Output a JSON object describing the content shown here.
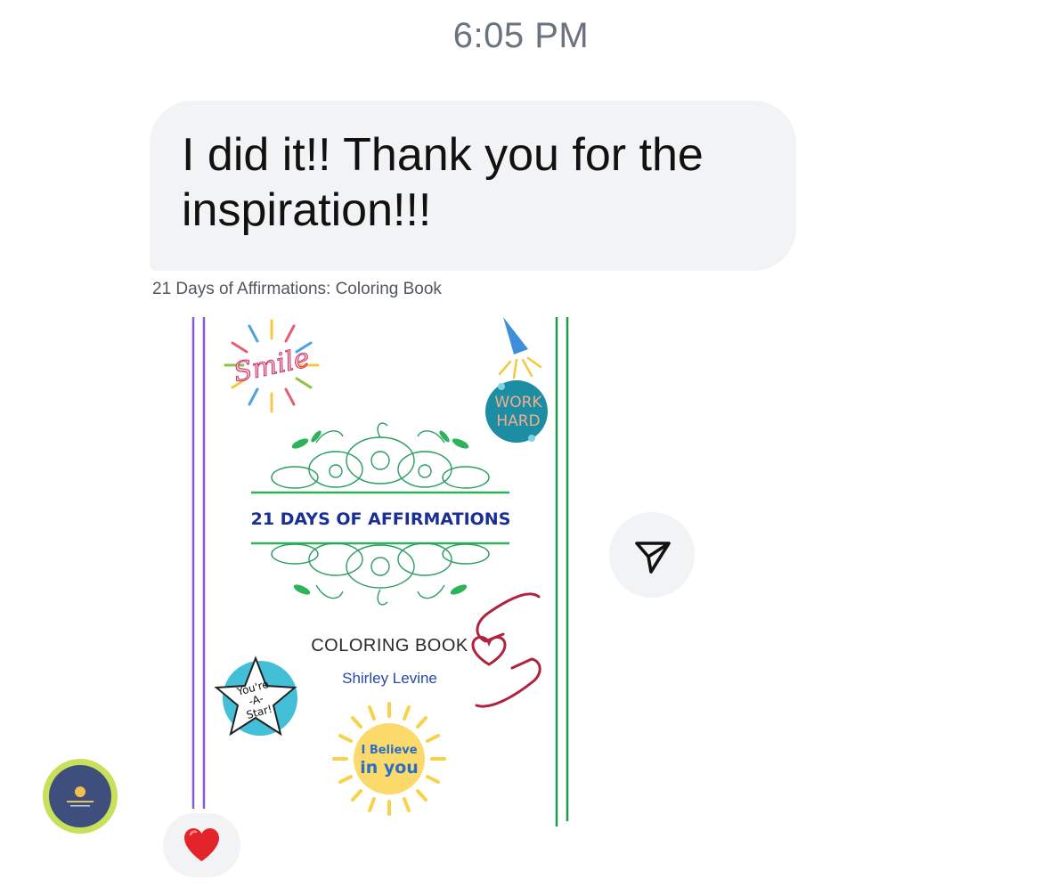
{
  "status": {
    "time": "6:05 PM"
  },
  "message": {
    "text": "I did it!! Thank you for the inspiration!!!",
    "attachment_caption": "21 Days of Affirmations: Coloring Book"
  },
  "cover": {
    "title": "21 DAYS OF AFFIRMATIONS",
    "subtitle": "COLORING BOOK",
    "author": "Shirley Levine",
    "sticker_smile": "Smile",
    "sticker_work_hard_1": "WORK",
    "sticker_work_hard_2": "HARD",
    "sticker_star_1": "You're",
    "sticker_star_2": "-A-",
    "sticker_star_3": "Star!",
    "sticker_believe_1": "I Believe",
    "sticker_believe_2": "in you"
  },
  "actions": {
    "share_icon": "send-icon"
  },
  "reaction": {
    "emoji_icon": "heart-icon"
  },
  "colors": {
    "bubble": "#f2f3f5",
    "title_blue": "#1a2f96",
    "border_green": "#1e9b4f",
    "border_purple": "#8a5cd0",
    "avatar_ring": "#c8e05a",
    "heart_red": "#e3242b"
  }
}
